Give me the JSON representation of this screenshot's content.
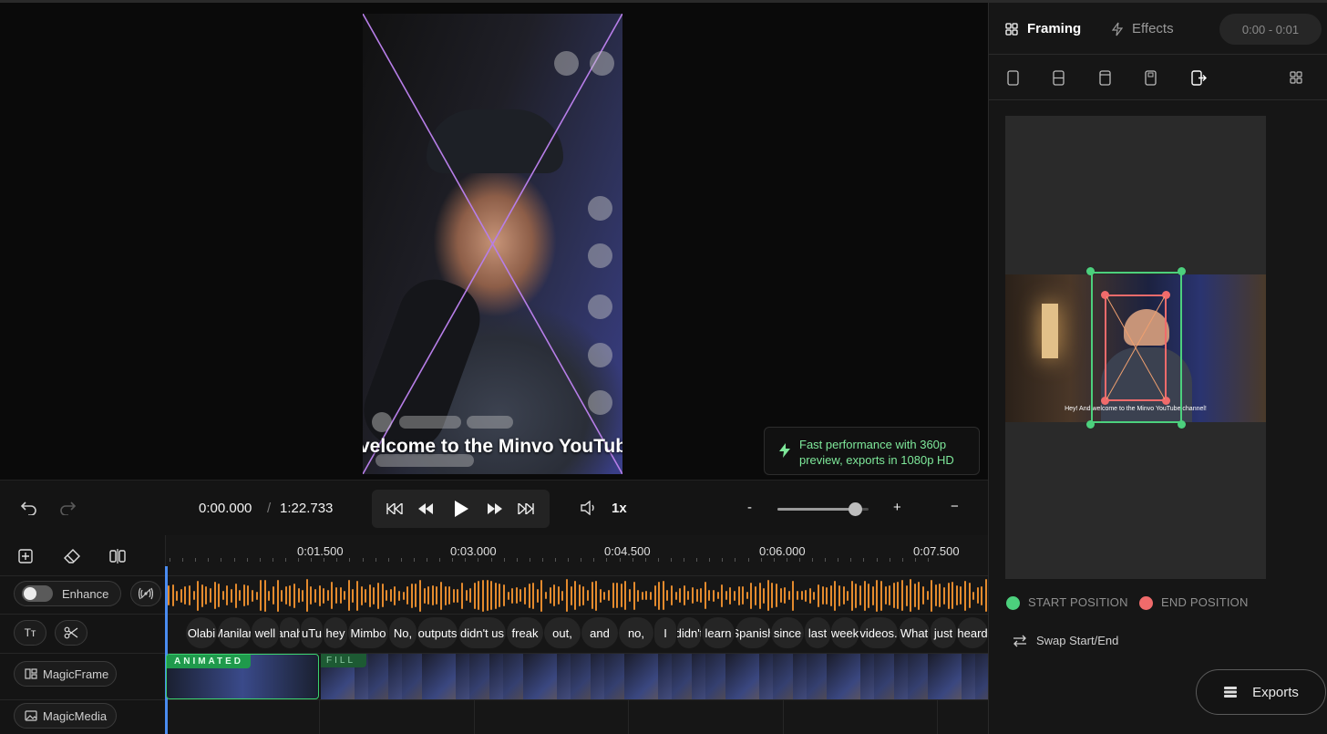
{
  "preview": {
    "caption": "velcome to the Minvo YouTub",
    "toast": "Fast performance with 360p preview, exports in 1080p HD"
  },
  "controls": {
    "current_time": "0:00.000",
    "separator": "/",
    "duration": "1:22.733",
    "speed": "1x",
    "zoom_out": "-",
    "zoom_in": "+",
    "collapse": "−",
    "zoom_level": 0.85
  },
  "timeline": {
    "ruler": [
      "0:01.500",
      "0:03.000",
      "0:04.500",
      "0:06.000",
      "0:07.500"
    ],
    "enhance_label": "Enhance",
    "magicframe_label": "MagicFrame",
    "magicmedia_label": "MagicMedia",
    "animated_badge": "ANIMATED",
    "fill_badge": "FILL",
    "words": [
      "Olabi",
      "Manilan",
      "well",
      "anah",
      "uTu",
      "hey",
      "Mimbo",
      "No,",
      "outputs",
      "didn't us",
      "freak",
      "out,",
      "and",
      "no,",
      "I",
      "didn't",
      "learn",
      "Spanish",
      "since",
      "last",
      "week",
      "videos.",
      "What",
      "just",
      "heard"
    ]
  },
  "panel": {
    "tab_framing": "Framing",
    "tab_effects": "Effects",
    "time_range": "0:00 - 0:01",
    "canvas_caption": "Hey! And welcome to the Minvo YouTube channel!",
    "start_label": "START POSITION",
    "end_label": "END POSITION",
    "swap_label": "Swap Start/End",
    "export_label": "Exports",
    "start_color": "#4cd07d",
    "end_color": "#f06b6b",
    "accent_waveform": "#e38a2d",
    "guide_color": "#b77ee8"
  }
}
